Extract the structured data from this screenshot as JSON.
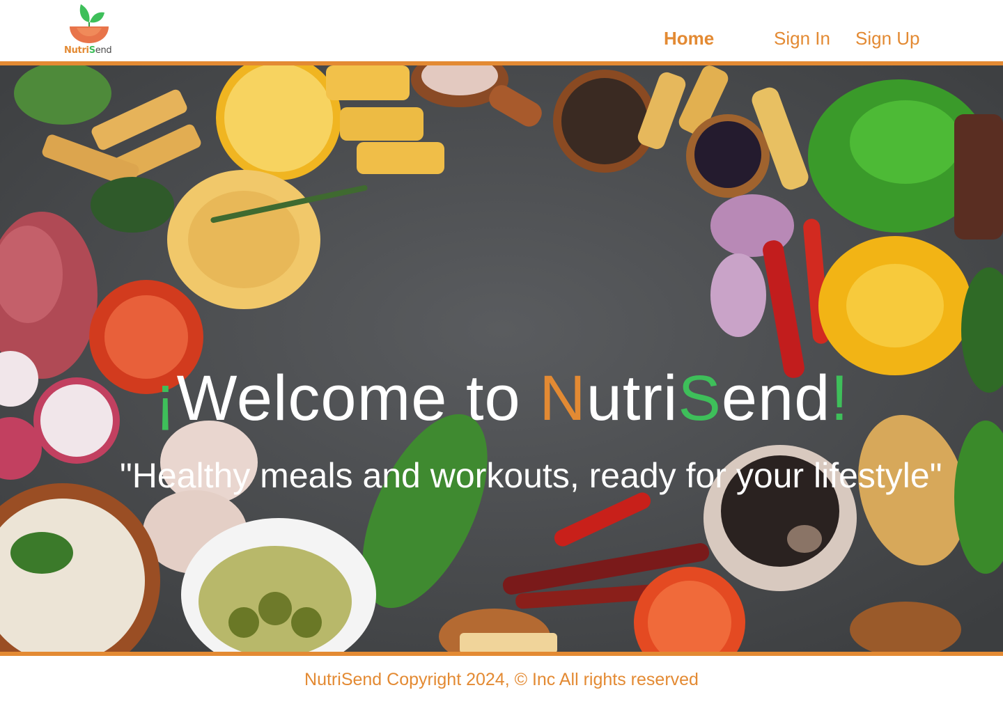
{
  "brand": {
    "name_part1": "Nutri",
    "name_part2": "S",
    "name_part3": "end",
    "colors": {
      "accent": "#e38a33",
      "green": "#3ebf5a",
      "text_dark": "#4a4a4a"
    }
  },
  "nav": {
    "home": "Home",
    "sign_in": "Sign In",
    "sign_up": "Sign Up",
    "active": "Home"
  },
  "hero": {
    "inverted_exclamation": "¡",
    "welcome_text": "Welcome to ",
    "name_N": "N",
    "name_utri": "utri",
    "name_S": "S",
    "name_end": "end",
    "exclamation": "!",
    "tagline": "\"Healthy meals and workouts, ready for your lifestyle\""
  },
  "footer": {
    "text": "NutriSend Copyright 2024, © Inc All rights reserved"
  },
  "icons": [
    "logo-bowl-leaf-icon"
  ]
}
